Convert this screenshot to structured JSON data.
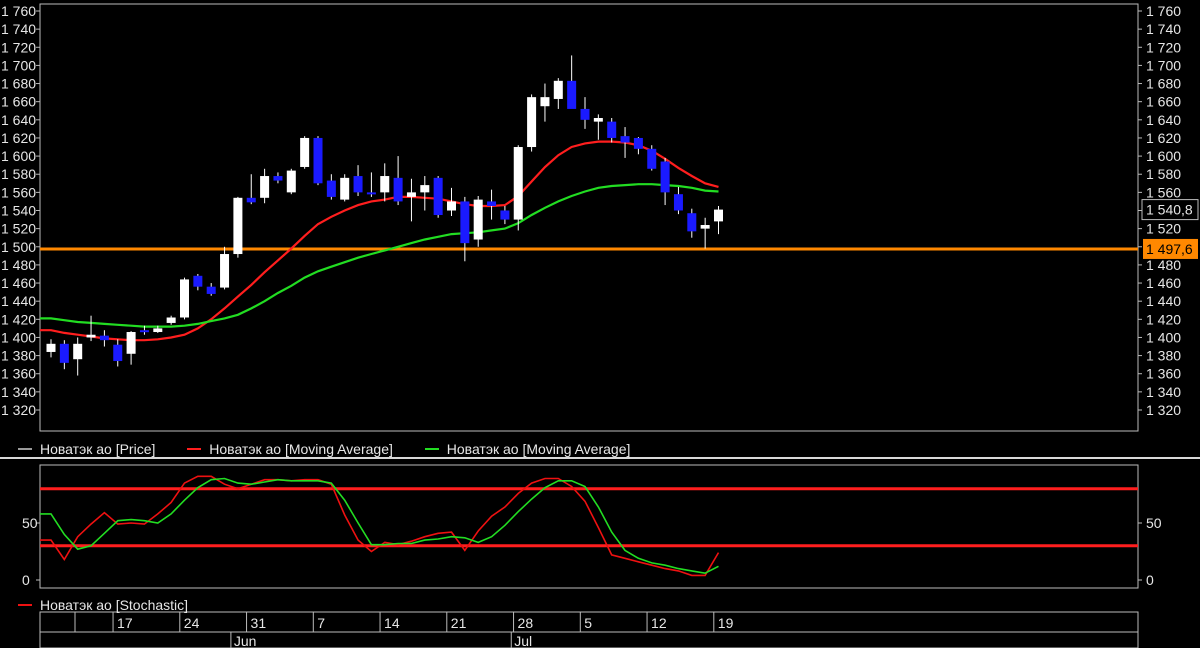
{
  "chart_data": [
    {
      "type": "candlestick",
      "ylim": [
        1310,
        1765
      ],
      "yticks": [
        "1 760",
        "1 740",
        "1 720",
        "1 700",
        "1 680",
        "1 660",
        "1 640",
        "1 620",
        "1 600",
        "1 580",
        "1 560",
        "1 540",
        "1 520",
        "1 500",
        "1 480",
        "1 460",
        "1 440",
        "1 420",
        "1 400",
        "1 380",
        "1 360",
        "1 340",
        "1 320"
      ],
      "ytick_values": [
        1760,
        1740,
        1720,
        1700,
        1680,
        1660,
        1640,
        1620,
        1600,
        1580,
        1560,
        1540,
        1520,
        1500,
        1480,
        1460,
        1440,
        1420,
        1400,
        1380,
        1360,
        1340,
        1320
      ],
      "up_color": "#ffffff",
      "down_color": "#1a1aff",
      "candles": [
        {
          "date": "2014-05-13",
          "o": 1384,
          "h": 1398,
          "l": 1378,
          "c": 1393
        },
        {
          "date": "2014-05-14",
          "o": 1393,
          "h": 1397,
          "l": 1365,
          "c": 1372
        },
        {
          "date": "2014-05-15",
          "o": 1376,
          "h": 1400,
          "l": 1358,
          "c": 1393
        },
        {
          "date": "2014-05-16",
          "o": 1400,
          "h": 1424,
          "l": 1396,
          "c": 1403
        },
        {
          "date": "2014-05-19",
          "o": 1402,
          "h": 1408,
          "l": 1390,
          "c": 1397
        },
        {
          "date": "2014-05-20",
          "o": 1392,
          "h": 1398,
          "l": 1368,
          "c": 1374
        },
        {
          "date": "2014-05-21",
          "o": 1382,
          "h": 1407,
          "l": 1370,
          "c": 1406
        },
        {
          "date": "2014-05-22",
          "o": 1408,
          "h": 1413,
          "l": 1403,
          "c": 1407
        },
        {
          "date": "2014-05-23",
          "o": 1406,
          "h": 1413,
          "l": 1405,
          "c": 1410
        },
        {
          "date": "2014-05-26",
          "o": 1416,
          "h": 1424,
          "l": 1414,
          "c": 1422
        },
        {
          "date": "2014-05-27",
          "o": 1422,
          "h": 1466,
          "l": 1420,
          "c": 1464
        },
        {
          "date": "2014-05-28",
          "o": 1468,
          "h": 1470,
          "l": 1452,
          "c": 1456
        },
        {
          "date": "2014-05-29",
          "o": 1456,
          "h": 1460,
          "l": 1446,
          "c": 1448
        },
        {
          "date": "2014-05-30",
          "o": 1455,
          "h": 1500,
          "l": 1453,
          "c": 1492
        },
        {
          "date": "2014-06-02",
          "o": 1492,
          "h": 1555,
          "l": 1488,
          "c": 1554
        },
        {
          "date": "2014-06-03",
          "o": 1554,
          "h": 1580,
          "l": 1547,
          "c": 1549
        },
        {
          "date": "2014-06-04",
          "o": 1554,
          "h": 1586,
          "l": 1548,
          "c": 1578
        },
        {
          "date": "2014-06-05",
          "o": 1578,
          "h": 1582,
          "l": 1570,
          "c": 1573
        },
        {
          "date": "2014-06-06",
          "o": 1560,
          "h": 1586,
          "l": 1558,
          "c": 1584
        },
        {
          "date": "2014-06-09",
          "o": 1588,
          "h": 1622,
          "l": 1586,
          "c": 1620
        },
        {
          "date": "2014-06-10",
          "o": 1620,
          "h": 1622,
          "l": 1568,
          "c": 1570
        },
        {
          "date": "2014-06-11",
          "o": 1573,
          "h": 1580,
          "l": 1552,
          "c": 1555
        },
        {
          "date": "2014-06-12",
          "o": 1552,
          "h": 1580,
          "l": 1550,
          "c": 1576
        },
        {
          "date": "2014-06-13",
          "o": 1578,
          "h": 1590,
          "l": 1556,
          "c": 1560
        },
        {
          "date": "2014-06-16",
          "o": 1560,
          "h": 1582,
          "l": 1555,
          "c": 1558
        },
        {
          "date": "2014-06-17",
          "o": 1560,
          "h": 1592,
          "l": 1550,
          "c": 1578
        },
        {
          "date": "2014-06-18",
          "o": 1576,
          "h": 1600,
          "l": 1546,
          "c": 1550
        },
        {
          "date": "2014-06-19",
          "o": 1555,
          "h": 1575,
          "l": 1528,
          "c": 1560
        },
        {
          "date": "2014-06-20",
          "o": 1560,
          "h": 1578,
          "l": 1540,
          "c": 1568
        },
        {
          "date": "2014-06-23",
          "o": 1576,
          "h": 1578,
          "l": 1532,
          "c": 1535
        },
        {
          "date": "2014-06-24",
          "o": 1540,
          "h": 1565,
          "l": 1534,
          "c": 1550
        },
        {
          "date": "2014-06-25",
          "o": 1550,
          "h": 1555,
          "l": 1484,
          "c": 1504
        },
        {
          "date": "2014-06-26",
          "o": 1508,
          "h": 1556,
          "l": 1500,
          "c": 1552
        },
        {
          "date": "2014-06-27",
          "o": 1550,
          "h": 1563,
          "l": 1530,
          "c": 1545
        },
        {
          "date": "2014-06-30",
          "o": 1540,
          "h": 1545,
          "l": 1525,
          "c": 1530
        },
        {
          "date": "2014-07-01",
          "o": 1530,
          "h": 1612,
          "l": 1518,
          "c": 1610
        },
        {
          "date": "2014-07-02",
          "o": 1610,
          "h": 1668,
          "l": 1605,
          "c": 1665
        },
        {
          "date": "2014-07-03",
          "o": 1655,
          "h": 1680,
          "l": 1638,
          "c": 1665
        },
        {
          "date": "2014-07-04",
          "o": 1663,
          "h": 1686,
          "l": 1652,
          "c": 1683
        },
        {
          "date": "2014-07-07",
          "o": 1683,
          "h": 1711,
          "l": 1655,
          "c": 1652
        },
        {
          "date": "2014-07-08",
          "o": 1652,
          "h": 1665,
          "l": 1630,
          "c": 1640
        },
        {
          "date": "2014-07-09",
          "o": 1638,
          "h": 1646,
          "l": 1618,
          "c": 1642
        },
        {
          "date": "2014-07-10",
          "o": 1638,
          "h": 1642,
          "l": 1615,
          "c": 1620
        },
        {
          "date": "2014-07-11",
          "o": 1622,
          "h": 1632,
          "l": 1598,
          "c": 1615
        },
        {
          "date": "2014-07-14",
          "o": 1620,
          "h": 1621,
          "l": 1602,
          "c": 1608
        },
        {
          "date": "2014-07-15",
          "o": 1608,
          "h": 1612,
          "l": 1584,
          "c": 1586
        },
        {
          "date": "2014-07-16",
          "o": 1594,
          "h": 1598,
          "l": 1546,
          "c": 1560
        },
        {
          "date": "2014-07-17",
          "o": 1558,
          "h": 1566,
          "l": 1536,
          "c": 1540
        },
        {
          "date": "2014-07-18",
          "o": 1537,
          "h": 1542,
          "l": 1510,
          "c": 1517
        },
        {
          "date": "2014-07-21",
          "o": 1520,
          "h": 1532,
          "l": 1498,
          "c": 1524
        },
        {
          "date": "2014-07-22",
          "o": 1528,
          "h": 1545,
          "l": 1514,
          "c": 1541
        }
      ],
      "moving_averages": [
        {
          "name": "Новатэк ао [Moving Average]",
          "color": "#ff1e1e",
          "values": [
            1408,
            1405,
            1403,
            1401,
            1399,
            1398,
            1397,
            1397,
            1398,
            1400,
            1403,
            1410,
            1420,
            1432,
            1445,
            1458,
            1472,
            1485,
            1498,
            1512,
            1525,
            1533,
            1540,
            1546,
            1550,
            1552,
            1555,
            1555,
            1554,
            1553,
            1550,
            1547,
            1545,
            1545,
            1546,
            1556,
            1572,
            1588,
            1601,
            1610,
            1614,
            1616,
            1616,
            1615,
            1612,
            1606,
            1597,
            1587,
            1578,
            1570,
            1566
          ]
        },
        {
          "name": "Новатэк ао [Moving Average]",
          "color": "#22dd22",
          "values": [
            1421,
            1419,
            1417,
            1416,
            1415,
            1414,
            1413,
            1412,
            1412,
            1412,
            1413,
            1415,
            1418,
            1421,
            1425,
            1432,
            1440,
            1449,
            1457,
            1466,
            1473,
            1478,
            1483,
            1488,
            1492,
            1496,
            1500,
            1504,
            1508,
            1511,
            1514,
            1515,
            1516,
            1518,
            1520,
            1526,
            1535,
            1543,
            1550,
            1556,
            1561,
            1565,
            1567,
            1568,
            1569,
            1569,
            1568,
            1567,
            1565,
            1562,
            1561
          ]
        }
      ],
      "hline": {
        "value": 1497.6,
        "label": "1 497,6",
        "color": "#ff8800"
      },
      "last_label": "1 540,8",
      "legend": [
        "Новатэк ао [Price]",
        "Новатэк ао [Moving Average]",
        "Новатэк ао [Moving Average]"
      ]
    },
    {
      "type": "line",
      "ylim": [
        -2,
        100
      ],
      "yticks": [
        "50",
        "0"
      ],
      "ytick_values": [
        50,
        0
      ],
      "levels": [
        80,
        30
      ],
      "level_color": "#ff1e1e",
      "series": [
        {
          "name": "Новатэк ао [Stochastic]",
          "color": "#ee1111",
          "values": [
            35,
            18,
            38,
            49,
            59,
            49,
            50,
            49,
            58,
            68,
            85,
            91,
            91,
            84,
            80,
            84,
            88,
            88,
            87,
            88,
            88,
            84,
            57,
            35,
            25,
            33,
            31,
            34,
            38,
            41,
            42,
            26,
            43,
            56,
            64,
            76,
            85,
            89,
            89,
            82,
            69,
            46,
            22,
            19,
            16,
            13,
            10,
            8,
            4,
            4,
            24
          ]
        },
        {
          "name": "",
          "color": "#22dd22",
          "values": [
            58,
            40,
            27,
            30,
            41,
            52,
            53,
            52,
            50,
            58,
            70,
            81,
            88,
            89,
            85,
            84,
            86,
            88,
            87,
            87,
            87,
            85,
            70,
            50,
            31,
            31,
            32,
            32,
            35,
            36,
            38,
            37,
            33,
            38,
            48,
            60,
            71,
            81,
            87,
            87,
            82,
            64,
            42,
            26,
            19,
            15,
            13,
            10,
            8,
            6,
            12
          ]
        }
      ],
      "legend": [
        "Новатэк ао [Stochastic]"
      ]
    }
  ],
  "xaxis": {
    "day_labels": [
      {
        "label": "17",
        "i": 3
      },
      {
        "label": "24",
        "i": 8
      },
      {
        "label": "31",
        "i": 13
      },
      {
        "label": "7",
        "i": 18
      },
      {
        "label": "14",
        "i": 23
      },
      {
        "label": "21",
        "i": 28
      },
      {
        "label": "28",
        "i": 33
      },
      {
        "label": "5",
        "i": 38
      },
      {
        "label": "12",
        "i": 43
      },
      {
        "label": "19",
        "i": 48
      }
    ],
    "month_labels": [
      {
        "label": "Jun",
        "i": 14
      },
      {
        "label": "Jul",
        "i": 35
      }
    ]
  },
  "legend_price": "Новатэк ао [Price]",
  "legend_ma1": "Новатэк ао [Moving Average]",
  "legend_ma2": "Новатэк ао [Moving Average]",
  "legend_stoch": "Новатэк ао [Stochastic]",
  "colors": {
    "price_legend": "#aaaaaa",
    "ma1": "#ff1e1e",
    "ma2": "#22dd22",
    "stoch": "#ee1111",
    "hline": "#ff8800"
  }
}
